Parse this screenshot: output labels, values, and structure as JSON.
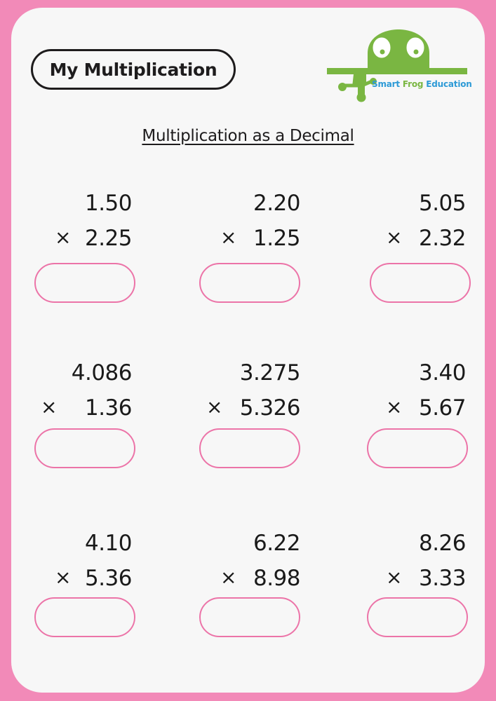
{
  "worksheet": {
    "title": "My Multiplication",
    "subtitle": "Multiplication as a Decimal",
    "operator_symbol": "×",
    "logo": {
      "name": "Smart Frog Education",
      "word_smart": "Smart",
      "word_frog": "Frog",
      "word_education": "Education",
      "colors": {
        "frog_green": "#7ab642",
        "text_blue": "#2d9ad6"
      }
    },
    "colors": {
      "border_pink": "#f28ab8",
      "answer_box_pink": "#ec74a8",
      "sheet_background": "#f7f7f7",
      "text": "#1e1c1d"
    },
    "problems": [
      {
        "multiplicand": "1.50",
        "multiplier": "2.25",
        "answer": ""
      },
      {
        "multiplicand": "2.20",
        "multiplier": "1.25",
        "answer": ""
      },
      {
        "multiplicand": "5.05",
        "multiplier": "2.32",
        "answer": ""
      },
      {
        "multiplicand": "4.086",
        "multiplier": "1.36",
        "answer": ""
      },
      {
        "multiplicand": "3.275",
        "multiplier": "5.326",
        "answer": ""
      },
      {
        "multiplicand": "3.40",
        "multiplier": "5.67",
        "answer": ""
      },
      {
        "multiplicand": "4.10",
        "multiplier": "5.36",
        "answer": ""
      },
      {
        "multiplicand": "6.22",
        "multiplier": "8.98",
        "answer": ""
      },
      {
        "multiplicand": "8.26",
        "multiplier": "3.33",
        "answer": ""
      }
    ]
  }
}
